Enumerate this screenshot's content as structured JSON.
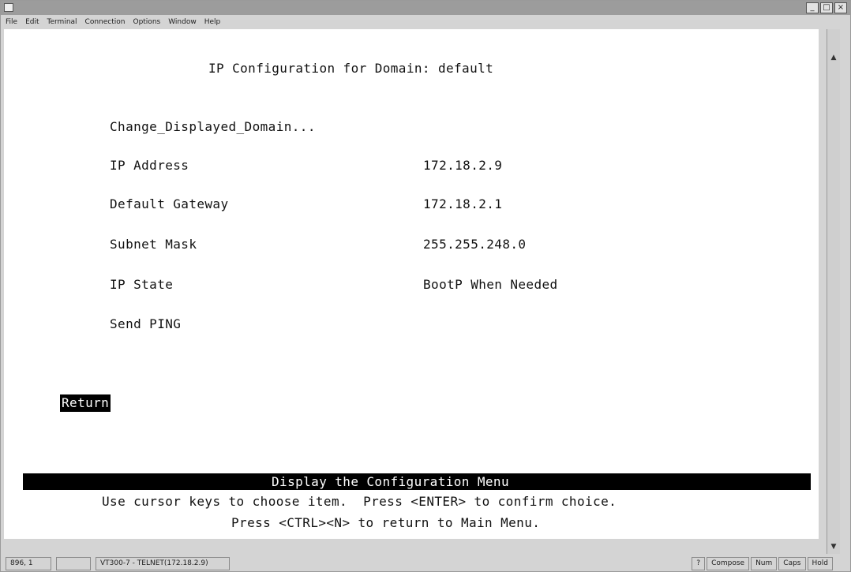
{
  "menu": [
    "File",
    "Edit",
    "Terminal",
    "Connection",
    "Options",
    "Window",
    "Help"
  ],
  "window_buttons": [
    "_",
    "□",
    "×"
  ],
  "terminal": {
    "title": "IP Configuration for Domain: default",
    "items": [
      {
        "label": "Change_Displayed_Domain...",
        "value": ""
      },
      {
        "label": "IP Address",
        "value": "172.18.2.9"
      },
      {
        "label": "Default Gateway",
        "value": "172.18.2.1"
      },
      {
        "label": "Subnet Mask",
        "value": "255.255.248.0"
      },
      {
        "label": "IP State",
        "value": "BootP When Needed"
      },
      {
        "label": "Send PING",
        "value": ""
      }
    ],
    "return_label": "Return",
    "status_line": "Display the Configuration Menu",
    "help_line_1": "Use cursor keys to choose item.  Press <ENTER> to confirm choice.",
    "help_line_2": "Press <CTRL><N> to return to Main Menu."
  },
  "statusbar": {
    "position": "896, 1",
    "session": "VT300-7 - TELNET(172.18.2.9)",
    "question": "?",
    "compose": "Compose",
    "num": "Num",
    "caps": "Caps",
    "hold": "Hold"
  }
}
